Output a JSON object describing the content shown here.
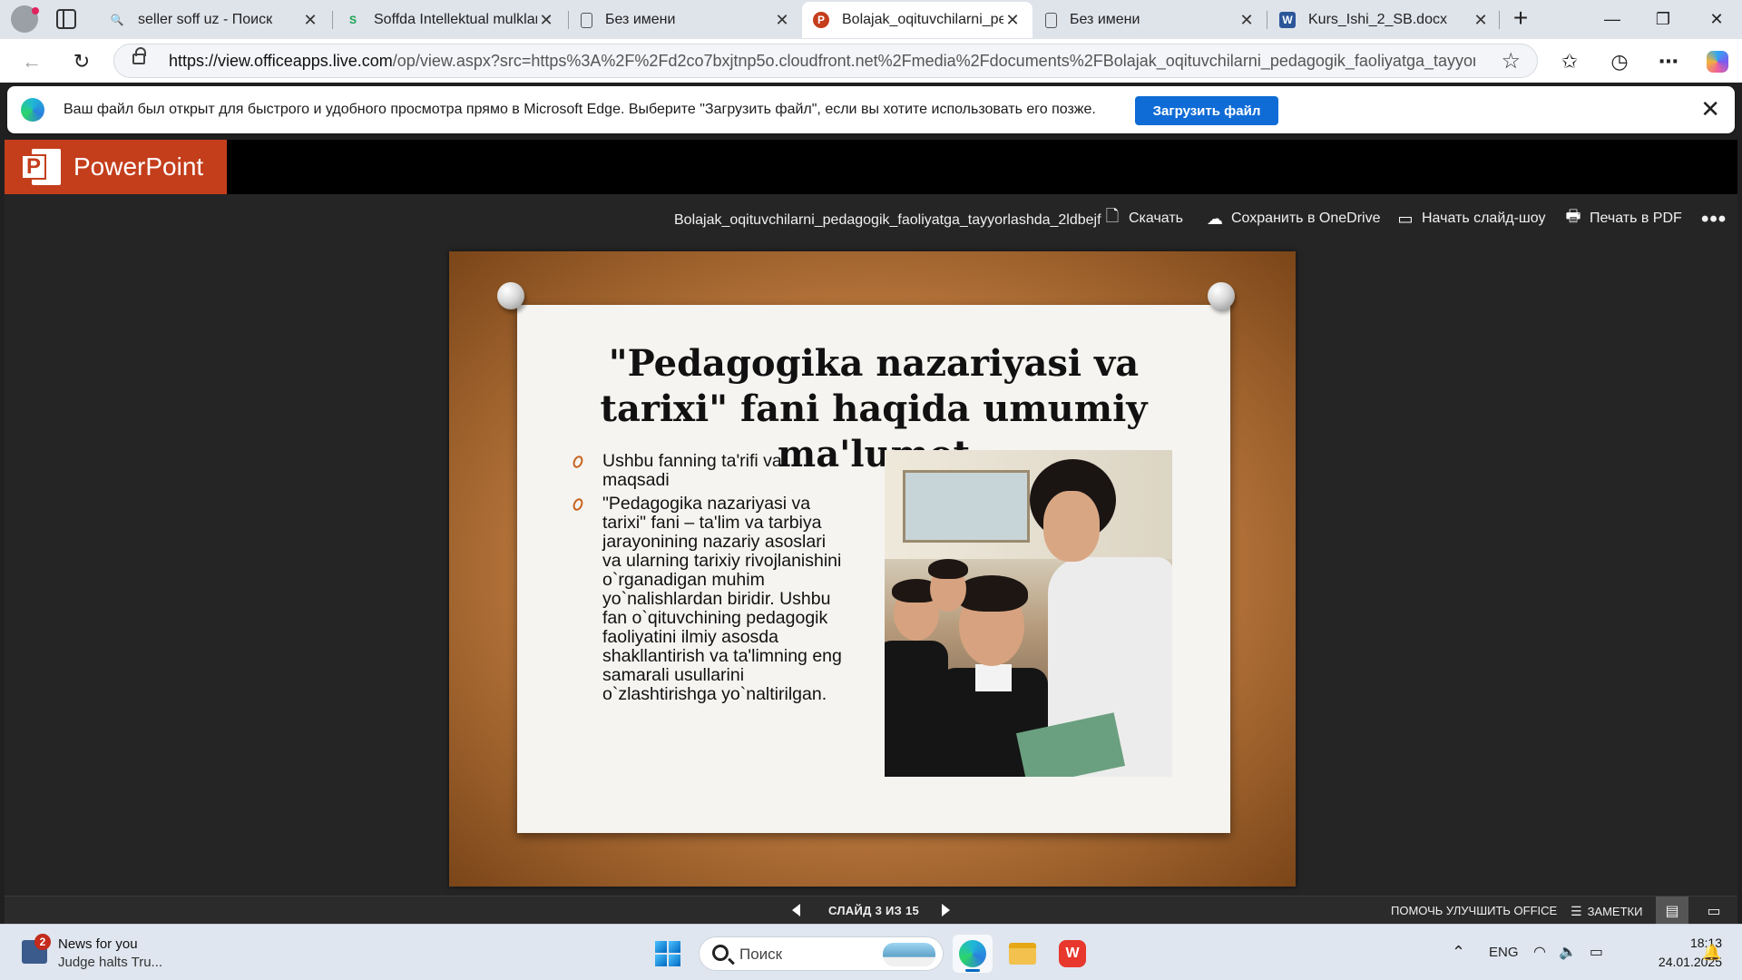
{
  "browser": {
    "tabs": [
      {
        "title": "seller soff uz - Поиск",
        "icon": "search-icon",
        "active": false
      },
      {
        "title": "Soffda Intellektual mulklarni",
        "icon": "soff-logo-icon",
        "active": false
      },
      {
        "title": "Без имени",
        "icon": "blank-page-icon",
        "active": false
      },
      {
        "title": "Bolajak_oqituvchilarni_pedagogik",
        "icon": "powerpoint-icon",
        "active": true
      },
      {
        "title": "Без имени",
        "icon": "blank-page-icon",
        "active": false
      },
      {
        "title": "Kurs_Ishi_2_SB.docx",
        "icon": "word-icon",
        "active": false
      }
    ],
    "url_host": "https://view.officeapps.live.com",
    "url_path": "/op/view.aspx?src=https%3A%2F%2Fd2co7bxjtnp5o.cloudfront.net%2Fmedia%2Fdocuments%2FBolajak_oqituvchilarni_pedagogik_faoliyatga_tayyorlashd..."
  },
  "infobar": {
    "message": "Ваш файл был открыт для быстрого и удобного просмотра прямо в Microsoft Edge. Выберите \"Загрузить файл\", если вы хотите использовать его позже.",
    "button_label": "Загрузить файл"
  },
  "app": {
    "brand": "PowerPoint",
    "brand_color": "#c43e1c",
    "filename": "Bolajak_oqituvchilarni_pedagogik_faoliyatga_tayyorlashda_2ldbejf",
    "commands": {
      "download": "Скачать",
      "save_onedrive": "Сохранить в OneDrive",
      "slideshow": "Начать слайд-шоу",
      "print_pdf": "Печать в PDF"
    }
  },
  "slide": {
    "title": "\"Pedagogika nazariyasi va tarixi\" fani haqida umumiy ma'lumot",
    "bullets": [
      "Ushbu fanning ta'rifi va maqsadi",
      "\"Pedagogika nazariyasi va tarixi\" fani – ta'lim va tarbiya jarayonining nazariy asoslari va ularning tarixiy rivojlanishini o`rganadigan muhim yo`nalishlardan biridir. Ushbu fan o`qituvchining pedagogik faoliyatini ilmiy asosda shakllantirish va ta'limning eng samarali usullarini o`zlashtirishga yo`naltirilgan."
    ],
    "bullet_color": "#c7631e"
  },
  "status": {
    "counter": "СЛАЙД 3 ИЗ 15",
    "help": "ПОМОЧЬ УЛУЧШИТЬ OFFICE",
    "notes": "ЗАМЕТКИ"
  },
  "taskbar": {
    "news_title": "News for you",
    "news_sub": "Judge halts Tru...",
    "news_badge": "2",
    "search_placeholder": "Поиск",
    "lang": "ENG",
    "time": "18:13",
    "date": "24.01.2025"
  }
}
